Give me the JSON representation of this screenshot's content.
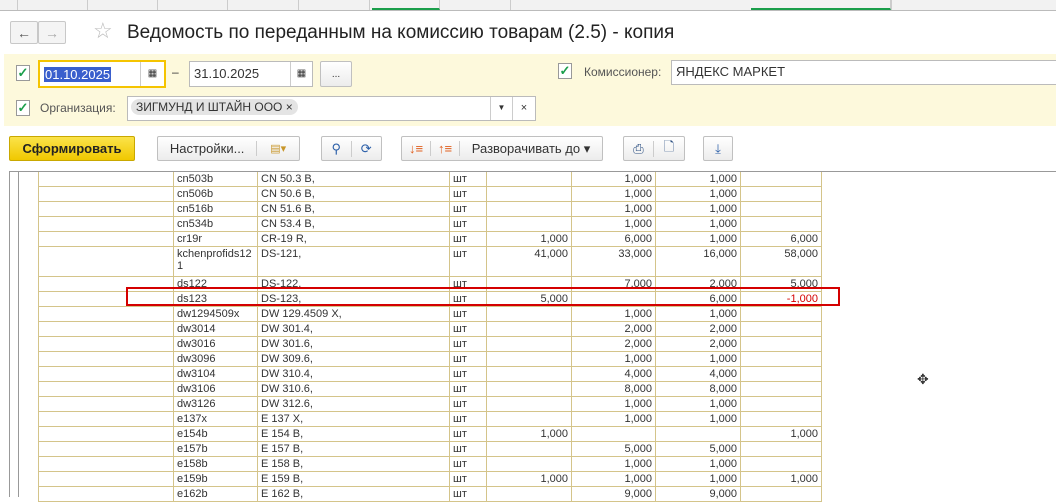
{
  "window": {
    "title": "Ведомость по переданным на комиссию товарам (2.5) - копия"
  },
  "filters": {
    "date_from": "01.10.2025",
    "date_to": "31.10.2025",
    "dash": "–",
    "period_button": "...",
    "org_label": "Организация:",
    "org_value": "ЗИГМУНД И ШТАЙН ООО",
    "agent_label": "Комиссионер:",
    "agent_value": "ЯНДЕКС МАРКЕТ"
  },
  "toolbar": {
    "generate": "Сформировать",
    "settings": "Настройки...",
    "expand": "Разворачивать до"
  },
  "colors": {
    "accent": "#f5d400",
    "highlight": "#d40000",
    "check": "#1a9e4a",
    "grid": "#d4c48a",
    "filter_bg": "#fdf9dc"
  },
  "rows": [
    [
      "cn503b",
      "CN 50.3 B,",
      "шт",
      "",
      "1,000",
      "1,000",
      ""
    ],
    [
      "cn506b",
      "CN 50.6 B,",
      "шт",
      "",
      "1,000",
      "1,000",
      ""
    ],
    [
      "cn516b",
      "CN 51.6 B,",
      "шт",
      "",
      "1,000",
      "1,000",
      ""
    ],
    [
      "cn534b",
      "CN 53.4 B,",
      "шт",
      "",
      "1,000",
      "1,000",
      ""
    ],
    [
      "cr19r",
      "CR-19 R,",
      "шт",
      "1,000",
      "6,000",
      "1,000",
      "6,000"
    ],
    [
      "kchenprofids121",
      "DS-121,",
      "шт",
      "41,000",
      "33,000",
      "16,000",
      "58,000"
    ],
    [
      "ds122",
      "DS-122,",
      "шт",
      "",
      "7,000",
      "2,000",
      "5,000"
    ],
    [
      "ds123",
      "DS-123,",
      "шт",
      "5,000",
      "",
      "6,000",
      "-1,000"
    ],
    [
      "dw1294509x",
      "DW 129.4509 X,",
      "шт",
      "",
      "1,000",
      "1,000",
      ""
    ],
    [
      "dw3014",
      "DW 301.4,",
      "шт",
      "",
      "2,000",
      "2,000",
      ""
    ],
    [
      "dw3016",
      "DW 301.6,",
      "шт",
      "",
      "2,000",
      "2,000",
      ""
    ],
    [
      "dw3096",
      "DW 309.6,",
      "шт",
      "",
      "1,000",
      "1,000",
      ""
    ],
    [
      "dw3104",
      "DW 310.4,",
      "шт",
      "",
      "4,000",
      "4,000",
      ""
    ],
    [
      "dw3106",
      "DW 310.6,",
      "шт",
      "",
      "8,000",
      "8,000",
      ""
    ],
    [
      "dw3126",
      "DW 312.6,",
      "шт",
      "",
      "1,000",
      "1,000",
      ""
    ],
    [
      "e137x",
      "E 137 X,",
      "шт",
      "",
      "1,000",
      "1,000",
      ""
    ],
    [
      "e154b",
      "E 154 B,",
      "шт",
      "1,000",
      "",
      "",
      "1,000"
    ],
    [
      "e157b",
      "E 157 B,",
      "шт",
      "",
      "5,000",
      "5,000",
      ""
    ],
    [
      "e158b",
      "E 158 B,",
      "шт",
      "",
      "1,000",
      "1,000",
      ""
    ],
    [
      "e159b",
      "E 159 B,",
      "шт",
      "1,000",
      "1,000",
      "1,000",
      "1,000"
    ],
    [
      "e162b",
      "E 162 B,",
      "шт",
      "",
      "9,000",
      "9,000",
      ""
    ]
  ]
}
